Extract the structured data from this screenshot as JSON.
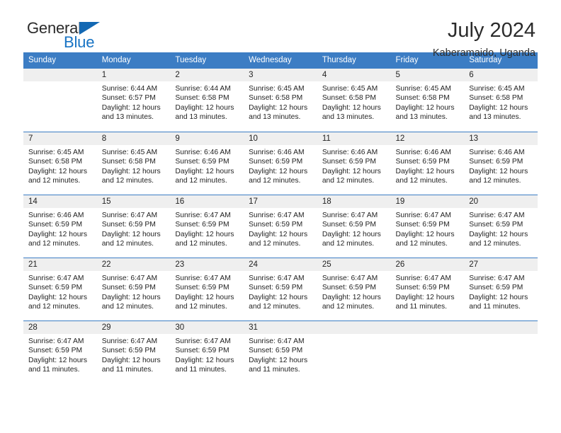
{
  "brand": {
    "name_part1": "General",
    "name_part2": "Blue",
    "flag_icon": "blue-flag-icon"
  },
  "header": {
    "title": "July 2024",
    "subtitle": "Kaberamaido, Uganda"
  },
  "colors": {
    "header_blue": "#3c7dc4",
    "brand_blue": "#1773c4",
    "daynum_bg": "#efefef",
    "text": "#232323"
  },
  "weekday_headers": [
    "Sunday",
    "Monday",
    "Tuesday",
    "Wednesday",
    "Thursday",
    "Friday",
    "Saturday"
  ],
  "weeks": [
    [
      {
        "day": "",
        "blank": true,
        "sunrise": "",
        "sunset": "",
        "daylight": ""
      },
      {
        "day": "1",
        "sunrise": "Sunrise: 6:44 AM",
        "sunset": "Sunset: 6:57 PM",
        "daylight": "Daylight: 12 hours and 13 minutes."
      },
      {
        "day": "2",
        "sunrise": "Sunrise: 6:44 AM",
        "sunset": "Sunset: 6:58 PM",
        "daylight": "Daylight: 12 hours and 13 minutes."
      },
      {
        "day": "3",
        "sunrise": "Sunrise: 6:45 AM",
        "sunset": "Sunset: 6:58 PM",
        "daylight": "Daylight: 12 hours and 13 minutes."
      },
      {
        "day": "4",
        "sunrise": "Sunrise: 6:45 AM",
        "sunset": "Sunset: 6:58 PM",
        "daylight": "Daylight: 12 hours and 13 minutes."
      },
      {
        "day": "5",
        "sunrise": "Sunrise: 6:45 AM",
        "sunset": "Sunset: 6:58 PM",
        "daylight": "Daylight: 12 hours and 13 minutes."
      },
      {
        "day": "6",
        "sunrise": "Sunrise: 6:45 AM",
        "sunset": "Sunset: 6:58 PM",
        "daylight": "Daylight: 12 hours and 13 minutes."
      }
    ],
    [
      {
        "day": "7",
        "sunrise": "Sunrise: 6:45 AM",
        "sunset": "Sunset: 6:58 PM",
        "daylight": "Daylight: 12 hours and 12 minutes."
      },
      {
        "day": "8",
        "sunrise": "Sunrise: 6:45 AM",
        "sunset": "Sunset: 6:58 PM",
        "daylight": "Daylight: 12 hours and 12 minutes."
      },
      {
        "day": "9",
        "sunrise": "Sunrise: 6:46 AM",
        "sunset": "Sunset: 6:59 PM",
        "daylight": "Daylight: 12 hours and 12 minutes."
      },
      {
        "day": "10",
        "sunrise": "Sunrise: 6:46 AM",
        "sunset": "Sunset: 6:59 PM",
        "daylight": "Daylight: 12 hours and 12 minutes."
      },
      {
        "day": "11",
        "sunrise": "Sunrise: 6:46 AM",
        "sunset": "Sunset: 6:59 PM",
        "daylight": "Daylight: 12 hours and 12 minutes."
      },
      {
        "day": "12",
        "sunrise": "Sunrise: 6:46 AM",
        "sunset": "Sunset: 6:59 PM",
        "daylight": "Daylight: 12 hours and 12 minutes."
      },
      {
        "day": "13",
        "sunrise": "Sunrise: 6:46 AM",
        "sunset": "Sunset: 6:59 PM",
        "daylight": "Daylight: 12 hours and 12 minutes."
      }
    ],
    [
      {
        "day": "14",
        "sunrise": "Sunrise: 6:46 AM",
        "sunset": "Sunset: 6:59 PM",
        "daylight": "Daylight: 12 hours and 12 minutes."
      },
      {
        "day": "15",
        "sunrise": "Sunrise: 6:47 AM",
        "sunset": "Sunset: 6:59 PM",
        "daylight": "Daylight: 12 hours and 12 minutes."
      },
      {
        "day": "16",
        "sunrise": "Sunrise: 6:47 AM",
        "sunset": "Sunset: 6:59 PM",
        "daylight": "Daylight: 12 hours and 12 minutes."
      },
      {
        "day": "17",
        "sunrise": "Sunrise: 6:47 AM",
        "sunset": "Sunset: 6:59 PM",
        "daylight": "Daylight: 12 hours and 12 minutes."
      },
      {
        "day": "18",
        "sunrise": "Sunrise: 6:47 AM",
        "sunset": "Sunset: 6:59 PM",
        "daylight": "Daylight: 12 hours and 12 minutes."
      },
      {
        "day": "19",
        "sunrise": "Sunrise: 6:47 AM",
        "sunset": "Sunset: 6:59 PM",
        "daylight": "Daylight: 12 hours and 12 minutes."
      },
      {
        "day": "20",
        "sunrise": "Sunrise: 6:47 AM",
        "sunset": "Sunset: 6:59 PM",
        "daylight": "Daylight: 12 hours and 12 minutes."
      }
    ],
    [
      {
        "day": "21",
        "sunrise": "Sunrise: 6:47 AM",
        "sunset": "Sunset: 6:59 PM",
        "daylight": "Daylight: 12 hours and 12 minutes."
      },
      {
        "day": "22",
        "sunrise": "Sunrise: 6:47 AM",
        "sunset": "Sunset: 6:59 PM",
        "daylight": "Daylight: 12 hours and 12 minutes."
      },
      {
        "day": "23",
        "sunrise": "Sunrise: 6:47 AM",
        "sunset": "Sunset: 6:59 PM",
        "daylight": "Daylight: 12 hours and 12 minutes."
      },
      {
        "day": "24",
        "sunrise": "Sunrise: 6:47 AM",
        "sunset": "Sunset: 6:59 PM",
        "daylight": "Daylight: 12 hours and 12 minutes."
      },
      {
        "day": "25",
        "sunrise": "Sunrise: 6:47 AM",
        "sunset": "Sunset: 6:59 PM",
        "daylight": "Daylight: 12 hours and 12 minutes."
      },
      {
        "day": "26",
        "sunrise": "Sunrise: 6:47 AM",
        "sunset": "Sunset: 6:59 PM",
        "daylight": "Daylight: 12 hours and 11 minutes."
      },
      {
        "day": "27",
        "sunrise": "Sunrise: 6:47 AM",
        "sunset": "Sunset: 6:59 PM",
        "daylight": "Daylight: 12 hours and 11 minutes."
      }
    ],
    [
      {
        "day": "28",
        "sunrise": "Sunrise: 6:47 AM",
        "sunset": "Sunset: 6:59 PM",
        "daylight": "Daylight: 12 hours and 11 minutes."
      },
      {
        "day": "29",
        "sunrise": "Sunrise: 6:47 AM",
        "sunset": "Sunset: 6:59 PM",
        "daylight": "Daylight: 12 hours and 11 minutes."
      },
      {
        "day": "30",
        "sunrise": "Sunrise: 6:47 AM",
        "sunset": "Sunset: 6:59 PM",
        "daylight": "Daylight: 12 hours and 11 minutes."
      },
      {
        "day": "31",
        "sunrise": "Sunrise: 6:47 AM",
        "sunset": "Sunset: 6:59 PM",
        "daylight": "Daylight: 12 hours and 11 minutes."
      },
      {
        "day": "",
        "blank": true,
        "sunrise": "",
        "sunset": "",
        "daylight": ""
      },
      {
        "day": "",
        "blank": true,
        "sunrise": "",
        "sunset": "",
        "daylight": ""
      },
      {
        "day": "",
        "blank": true,
        "sunrise": "",
        "sunset": "",
        "daylight": ""
      }
    ]
  ]
}
